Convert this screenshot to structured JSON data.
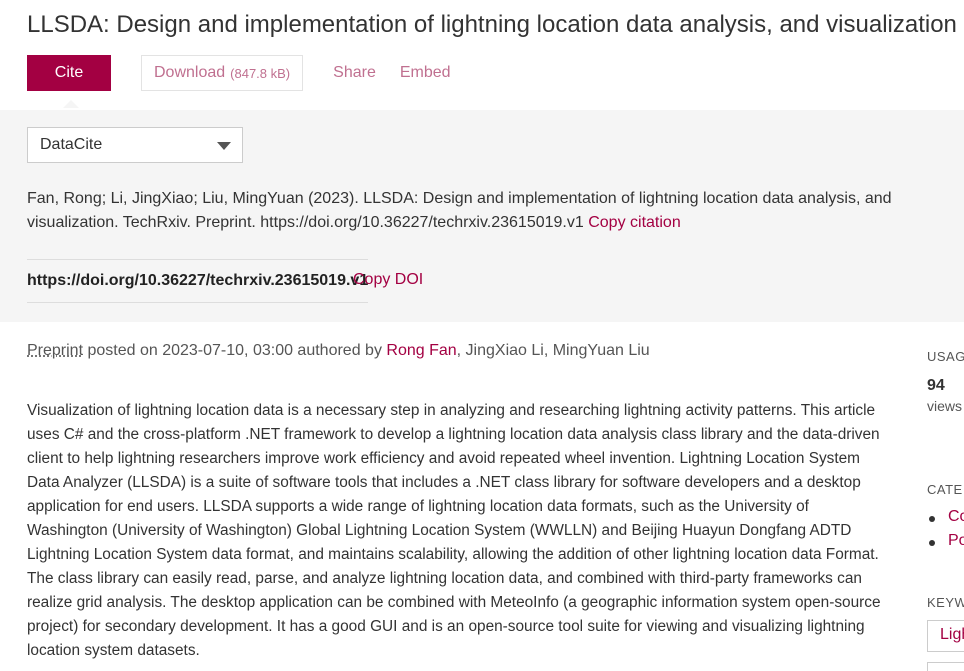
{
  "page": {
    "title": "LLSDA: Design and implementation of lightning location data analysis, and visualization"
  },
  "actions": {
    "cite_label": "Cite",
    "download_label": "Download",
    "download_size": "(847.8 kB)",
    "share_label": "Share",
    "embed_label": "Embed"
  },
  "citation": {
    "style_selected": "DataCite",
    "text": "Fan, Rong; Li, JingXiao; Liu, MingYuan (2023). LLSDA: Design and implementation of lightning location data analysis, and visualization. TechRxiv. Preprint. https://doi.org/10.36227/techrxiv.23615019.v1",
    "copy_citation_label": "Copy citation",
    "doi": "https://doi.org/10.36227/techrxiv.23615019.v1",
    "copy_doi_label": "Copy DOI"
  },
  "meta": {
    "item_type": "Preprint",
    "posted_text": "posted on 2023-07-10, 03:00 authored by",
    "authors": [
      "Rong Fan",
      "JingXiao Li",
      "MingYuan Liu"
    ]
  },
  "abstract": "Visualization of lightning location data is a necessary step in analyzing and researching lightning activity patterns. This article uses C# and the cross-platform .NET framework to develop a lightning location data analysis class library and the data-driven client to help lightning researchers improve work efficiency and avoid repeated wheel invention. Lightning Location System Data Analyzer (LLSDA) is a suite of software tools that includes a .NET class library for software developers and a desktop application for end users. LLSDA supports a wide range of lightning location data formats, such as the University of Washington (University of Washington) Global Lightning Location System (WWLLN) and Beijing Huayun Dongfang ADTD Lightning Location System data format, and maintains scalability, allowing the addition of other lightning location data Format. The class library can easily read, parse, and analyze lightning location data, and combined with third-party frameworks can realize grid analysis. The desktop application can be combined with MeteoInfo (a geographic information system open-source project) for secondary development. It has a good GUI and is an open-source tool suite for viewing and visualizing lightning location system datasets.",
  "sidebar": {
    "usage_heading": "USAG",
    "views_count": "94",
    "views_label": "views",
    "categories_heading": "CATE",
    "categories": [
      "Co",
      "Po"
    ],
    "keywords_heading": "KEYW",
    "keywords": [
      "Ligh"
    ]
  },
  "colors": {
    "accent": "#a30042",
    "link": "#c07090",
    "panel_bg": "#f5f5f5"
  }
}
